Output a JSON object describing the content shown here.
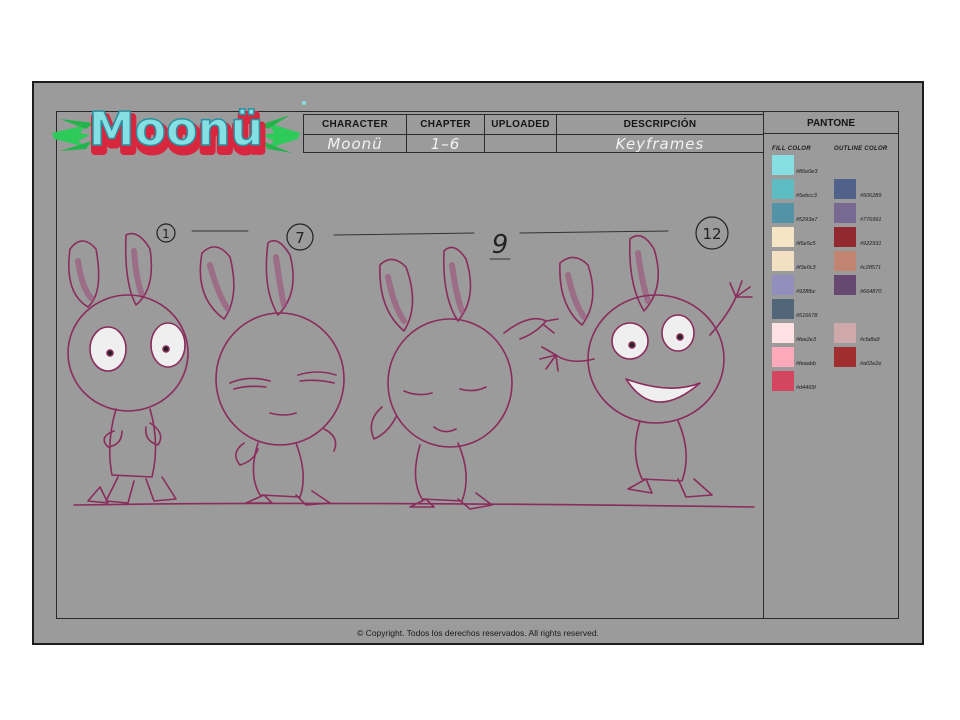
{
  "header": {
    "columns": [
      {
        "label": "CHARACTER",
        "value": "Moonü"
      },
      {
        "label": "CHAPTER",
        "value": "1–6"
      },
      {
        "label": "UPLOADED",
        "value": ""
      },
      {
        "label": "DESCRIPCIÓN",
        "value": "Keyframes"
      }
    ],
    "pantone_label": "PANTONE"
  },
  "logo": {
    "text": "Moonü",
    "fill": "#86e0e3",
    "shadow": "#d9263f"
  },
  "pantone": {
    "fill_label": "FILL COLOR",
    "outline_label": "OUTLINE COLOR",
    "fill": [
      {
        "code": "#86e0e3",
        "hex": "#86e0e3"
      },
      {
        "code": "#5ebcc3",
        "hex": "#5ebcc3"
      },
      {
        "code": "#5293a7",
        "hex": "#5293a7"
      },
      {
        "code": "#f6e5c5",
        "hex": "#f6e5c5"
      },
      {
        "code": "#f3e0c3",
        "hex": "#f3e0c3"
      },
      {
        "code": "#928fbc",
        "hex": "#928fbc"
      },
      {
        "code": "#516678",
        "hex": "#516678"
      },
      {
        "code": "#fee2e3",
        "hex": "#fee2e3"
      },
      {
        "code": "#feaabb",
        "hex": "#feaabb"
      },
      {
        "code": "#d4465f",
        "hex": "#d4465f"
      }
    ],
    "outline": [
      {
        "code": "#506289",
        "hex": "#506289"
      },
      {
        "code": "#776991",
        "hex": "#776991"
      },
      {
        "code": "#922931",
        "hex": "#922931"
      },
      {
        "code": "#c28571",
        "hex": "#c28571"
      },
      {
        "code": "#664870",
        "hex": "#664870"
      },
      {
        "code": "#cfa8a9",
        "hex": "#cfa8a9"
      },
      {
        "code": "#a02e2e",
        "hex": "#a02e2e"
      }
    ]
  },
  "keyframes": [
    "1",
    "7",
    "9",
    "12"
  ],
  "footer": {
    "copyright": "© Copyright. Todos los derechos reservados. All rights reserved."
  },
  "colors": {
    "sheet": "#9b9b9b",
    "sketch": "#8a2c5c",
    "ear_inner": "#9c4f78"
  }
}
